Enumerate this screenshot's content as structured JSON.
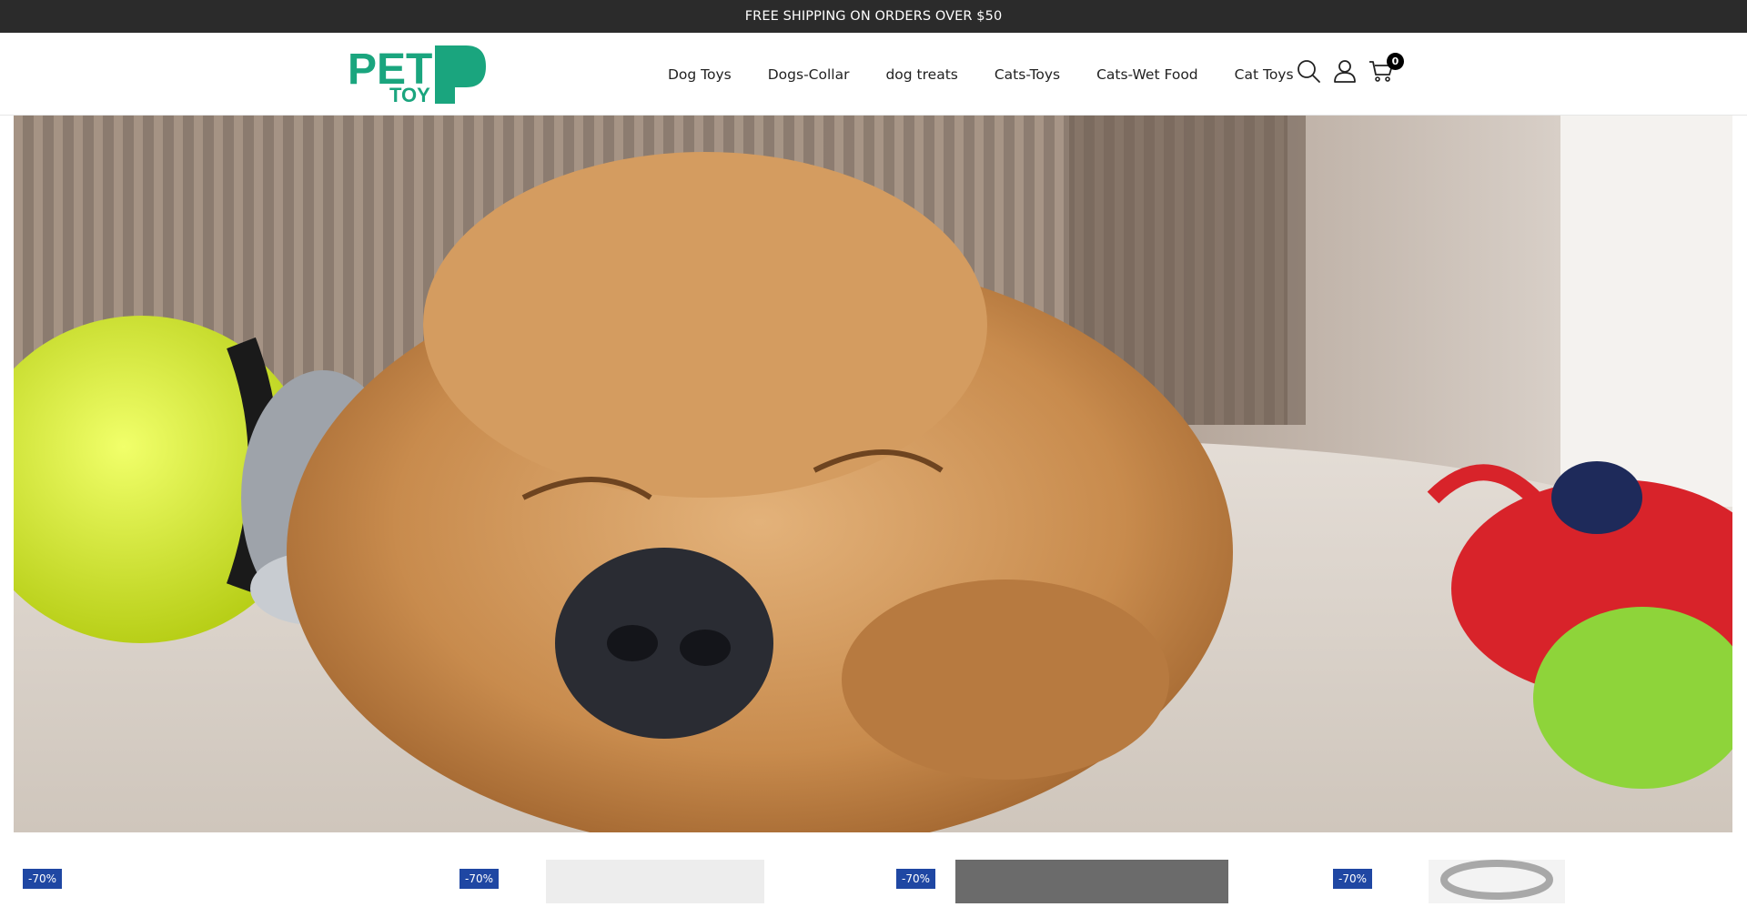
{
  "announcement": {
    "text": "FREE SHIPPING ON ORDERS OVER $50"
  },
  "header": {
    "logo": {
      "line1": "PET",
      "line2": "TOY",
      "brand_color": "#1aa57e"
    },
    "nav": [
      "Dog Toys",
      "Dogs-Collar",
      "dog treats",
      "Cats-Toys",
      "Cats-Wet Food",
      "Cat Toys"
    ],
    "icons": {
      "search": "search-icon",
      "account": "user-icon",
      "cart": "cart-icon"
    },
    "cart_count": "0"
  },
  "hero": {
    "image": "sleeping-puppy-with-toys-banner"
  },
  "products": {
    "badges": [
      "-70%",
      "-70%",
      "-70%",
      "-70%"
    ],
    "badge_color": "#1f47a3"
  }
}
